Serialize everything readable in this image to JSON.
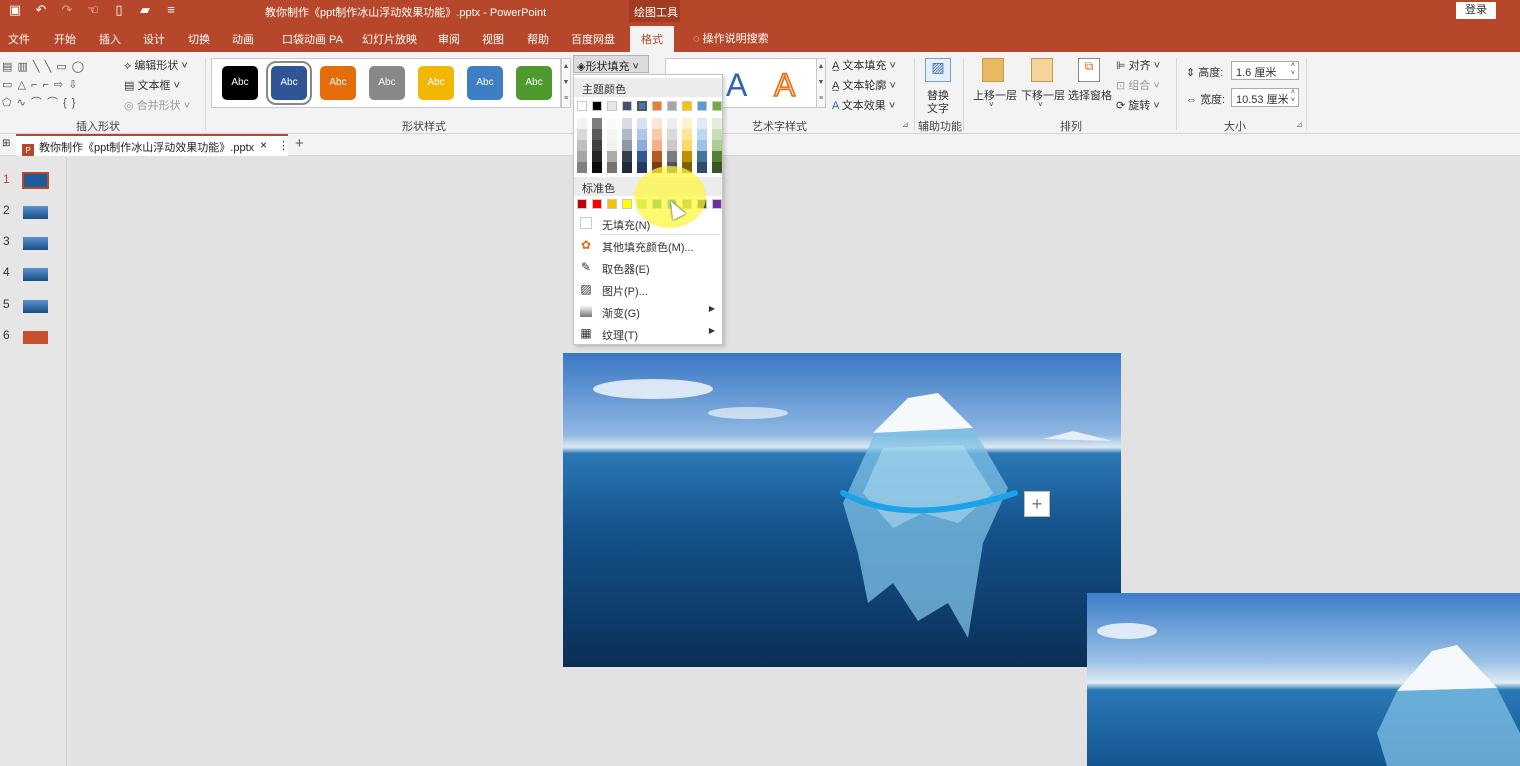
{
  "titlebar": {
    "title": "教你制作《ppt制作冰山浮动效果功能》.pptx  -  PowerPoint",
    "context_tool": "绘图工具",
    "login": "登录",
    "qat_icons": [
      "save-icon",
      "undo-icon",
      "redo-icon",
      "touch-mode-icon",
      "new-file-icon",
      "open-folder-icon",
      "customize-icon"
    ]
  },
  "tabs": [
    "文件",
    "开始",
    "插入",
    "设计",
    "切换",
    "动画",
    "口袋动画 PA",
    "幻灯片放映",
    "审阅",
    "视图",
    "帮助",
    "百度网盘",
    "格式"
  ],
  "active_tab": "格式",
  "tell_me": "操作说明搜索",
  "ribbon": {
    "insert_shapes": {
      "label": "插入形状",
      "edit_shape": "编辑形状",
      "text_box": "文本框",
      "merge_shapes": "合并形状"
    },
    "shape_styles": {
      "label": "形状样式",
      "swatch_text": "Abc",
      "swatches": [
        "#000000",
        "#2f5597",
        "#e46c0a",
        "#888888",
        "#f2b705",
        "#3e7ec3",
        "#4e9a2f"
      ],
      "selected_index": 1,
      "fill_button": "形状填充"
    },
    "wordart": {
      "label": "艺术字样式",
      "glyph": "A",
      "text_fill": "文本填充",
      "text_outline": "文本轮廓",
      "text_effects": "文本效果"
    },
    "accessibility": {
      "label": "辅助功能",
      "alt_text_1": "替换",
      "alt_text_2": "文字"
    },
    "arrange": {
      "label": "排列",
      "bring_forward": "上移一层",
      "send_backward": "下移一层",
      "selection_pane": "选择窗格",
      "align": "对齐",
      "group": "组合",
      "rotate": "旋转"
    },
    "size": {
      "label": "大小",
      "height_label": "高度:",
      "height_value": "1.6 厘米",
      "width_label": "宽度:",
      "width_value": "10.53 厘米"
    }
  },
  "doc_tab": {
    "name": "教你制作《ppt制作冰山浮动效果功能》.pptx",
    "close": "×",
    "more": "⋮",
    "add": "+"
  },
  "slides": [
    "1",
    "2",
    "3",
    "4",
    "5",
    "6"
  ],
  "color_menu": {
    "theme_header": "主题颜色",
    "theme_colors": [
      "#ffffff",
      "#000000",
      "#e7e6e6",
      "#44546a",
      "#4472c4",
      "#ed7d31",
      "#a5a5a5",
      "#ffc000",
      "#5b9bd5",
      "#70ad47"
    ],
    "standard_header": "标准色",
    "standard_colors": [
      "#c00000",
      "#ff0000",
      "#ffc000",
      "#ffff00",
      "#92d050",
      "#00b050",
      "#00b0f0",
      "#70ad47",
      "#375623",
      "#7030a0"
    ],
    "no_fill": "无填充(N)",
    "more_colors": "其他填充颜色(M)...",
    "eyedropper": "取色器(E)",
    "picture": "图片(P)...",
    "gradient": "渐变(G)",
    "texture": "纹理(T)"
  }
}
